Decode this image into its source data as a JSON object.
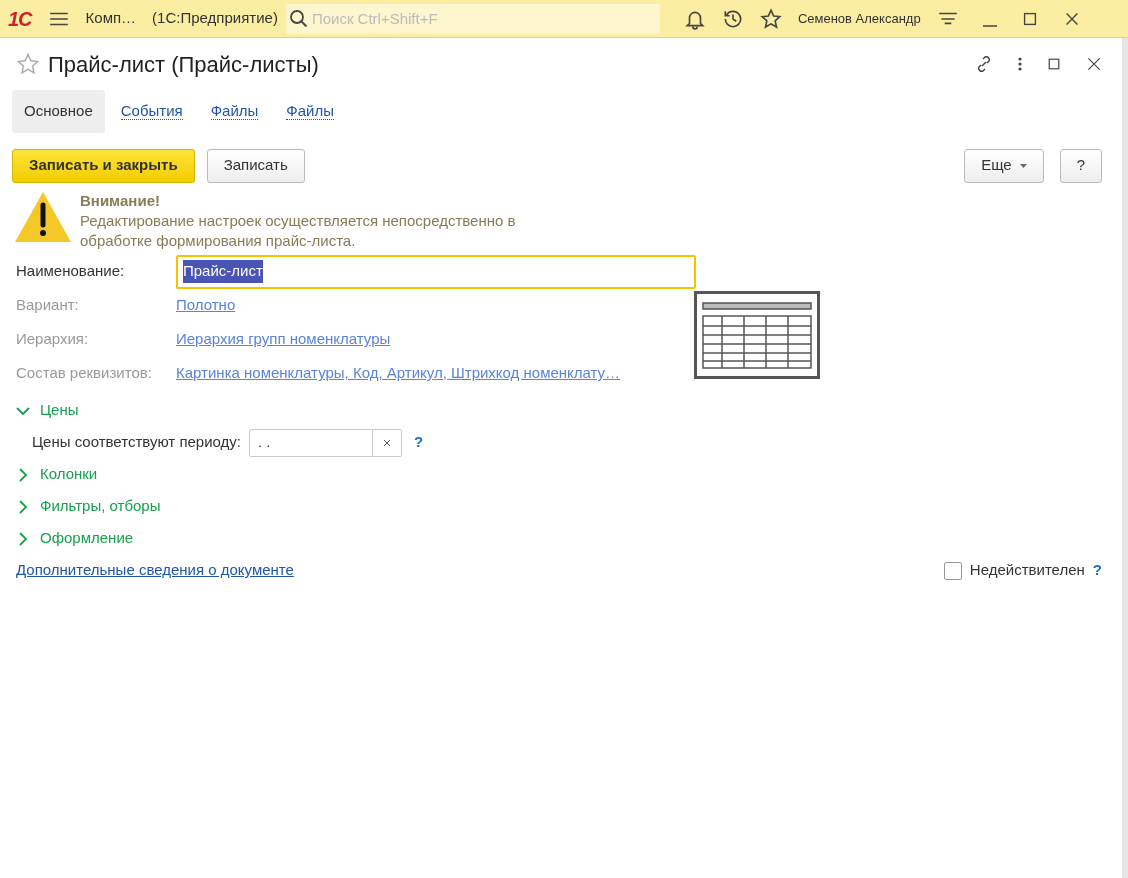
{
  "app_bar": {
    "logo": "1С",
    "title": "Комп…",
    "subtitle": "(1С:Предприятие)",
    "search": {
      "placeholder": "Поиск Ctrl+Shift+F"
    },
    "user": "Семенов Александр"
  },
  "form": {
    "title": "Прайс-лист (Прайс-листы)",
    "favorite": false,
    "tabs": [
      {
        "label": "Основное",
        "selected": true
      },
      {
        "label": "События",
        "selected": false
      },
      {
        "label": "Файлы",
        "selected": false
      },
      {
        "label": "Файлы",
        "selected": false
      }
    ],
    "buttons": [
      {
        "label": "Записать и закрыть",
        "kind": "primary"
      },
      {
        "label": "Записать",
        "kind": "default"
      }
    ],
    "more_button": "Еще",
    "help_button": "?",
    "warning": {
      "title": "Внимание!",
      "text": "Редактирование настроек осуществляется непосредственно в обработке формирования прайс-листа."
    },
    "fields": [
      {
        "label": "Наименование:",
        "value": "Прайс-лист",
        "kind": "input",
        "text_selected": true
      },
      {
        "label": "Вариант:",
        "value": "Полотно",
        "kind": "link"
      },
      {
        "label": "Иерархия:",
        "value": "Иерархия групп номенклатуры",
        "kind": "link"
      },
      {
        "label": "Состав реквизитов:",
        "value": "Картинка номенклатуры, Код, Артикул, Штрихкод номенклату…",
        "kind": "link"
      }
    ],
    "sections": [
      {
        "title": "Цены",
        "expanded": true,
        "period_label": "Цены соответствуют периоду:",
        "period_value": " .  .",
        "help": "?"
      },
      {
        "title": "Колонки",
        "expanded": false
      },
      {
        "title": "Фильтры, отборы",
        "expanded": false
      },
      {
        "title": "Оформление",
        "expanded": false
      }
    ],
    "footer_link": "Дополнительные сведения о документе",
    "invalid": {
      "label": "Недействителен",
      "checked": false,
      "help": "?"
    }
  }
}
